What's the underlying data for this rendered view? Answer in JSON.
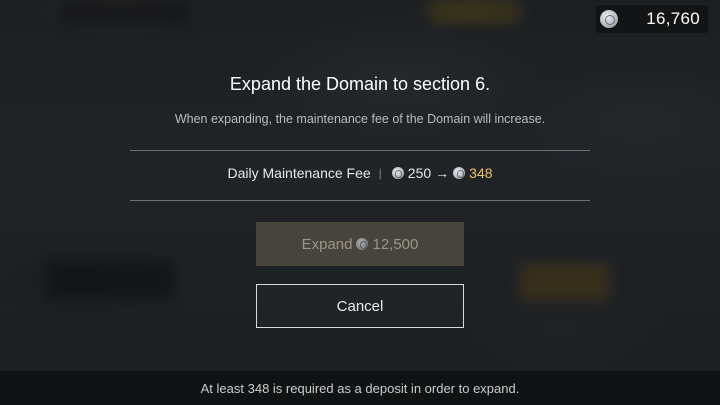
{
  "currency": {
    "amount": "16,760",
    "icon": "silver-coin-icon"
  },
  "dialog": {
    "title": "Expand the Domain to section 6.",
    "subtitle": "When expanding, the maintenance fee of the Domain will increase.",
    "fee": {
      "label": "Daily Maintenance Fee",
      "separator": "|",
      "current": "250",
      "arrow": "→",
      "new": "348",
      "new_color": "#e9c25a"
    },
    "expand_button": {
      "label": "Expand",
      "cost": "12,500",
      "state": "disabled"
    },
    "cancel_button": {
      "label": "Cancel"
    }
  },
  "footer": {
    "message": "At least 348 is required as a deposit in order to expand."
  }
}
